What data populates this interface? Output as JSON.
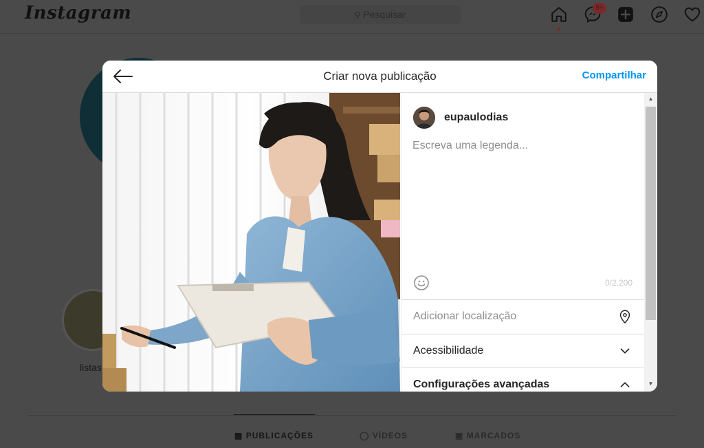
{
  "background": {
    "logo": "Instagram",
    "search_placeholder": "Pesquisar",
    "notification_count": "9+",
    "nav_icons": [
      "home-icon",
      "messenger-icon",
      "new-post-icon",
      "explore-icon",
      "heart-icon"
    ],
    "highlight_label": "listas",
    "tabs": [
      {
        "label": "PUBLICAÇÕES",
        "icon": "grid-icon",
        "active": true
      },
      {
        "label": "VÍDEOS",
        "icon": "video-icon",
        "active": false
      },
      {
        "label": "MARCADOS",
        "icon": "tagged-icon",
        "active": false
      }
    ]
  },
  "modal": {
    "title": "Criar nova publicação",
    "share_label": "Compartilhar",
    "back_icon": "arrow-left-icon",
    "username": "eupaulodias",
    "caption_placeholder": "Escreva uma legenda...",
    "caption_value": "",
    "char_count": "0/2.200",
    "emoji_icon": "emoji-icon",
    "rows": {
      "location": {
        "label": "Adicionar localização",
        "icon": "location-pin-icon"
      },
      "accessibility": {
        "label": "Acessibilidade",
        "icon": "chevron-down-icon"
      },
      "advanced": {
        "label": "Configurações avançadas",
        "icon": "chevron-up-icon"
      }
    }
  },
  "colors": {
    "accent": "#0095f6",
    "overlay": "#4a4a4a",
    "text": "#262626",
    "muted": "#8e8e8e"
  }
}
